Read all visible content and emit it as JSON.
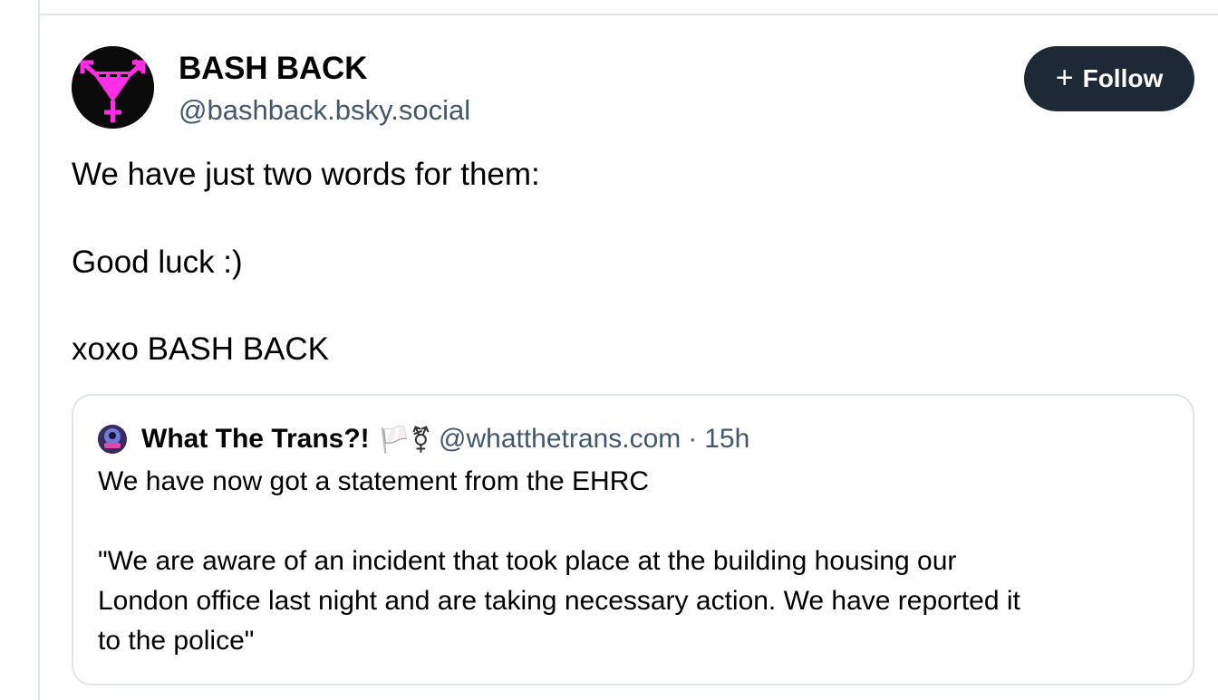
{
  "post": {
    "author": {
      "display_name": "BASH BACK",
      "handle": "@bashback.bsky.social",
      "avatar_icon": "trans-symbol-magenta-icon"
    },
    "follow_button": {
      "icon": "plus-icon",
      "label": "Follow"
    },
    "text_lines": [
      "We have just two words for them:",
      "Good luck :)",
      "xoxo BASH BACK"
    ]
  },
  "quote": {
    "author": {
      "display_name": "What The Trans?!",
      "emoji": "🏳️⚧",
      "handle": "@whatthetrans.com",
      "separator": "·",
      "time": "15h",
      "avatar_icon": "what-the-trans-avatar-icon"
    },
    "text_lines": [
      "We have now got a statement from the EHRC",
      "\"We are aware of an incident that took place at the building housing our",
      "London office last night and are taking necessary action. We have reported it",
      "to the police\""
    ]
  },
  "colors": {
    "follow_bg": "#1e2937",
    "handle_gray": "#42576c",
    "border": "#dfe5ee",
    "accent_magenta": "#ff2ee6"
  }
}
